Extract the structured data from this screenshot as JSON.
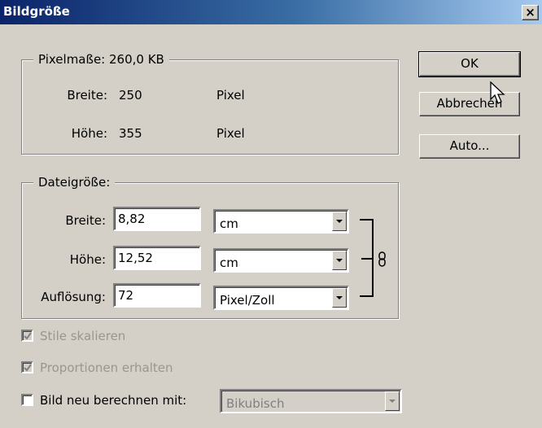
{
  "window": {
    "title": "Bildgröße"
  },
  "pixel_group": {
    "legend": "Pixelmaße: 260,0 KB",
    "width_label": "Breite:",
    "width_value": "250",
    "width_unit": "Pixel",
    "height_label": "Höhe:",
    "height_value": "355",
    "height_unit": "Pixel"
  },
  "doc_group": {
    "legend": "Dateigröße:",
    "width_label": "Breite:",
    "width_value": "8,82",
    "width_unit": "cm",
    "height_label": "Höhe:",
    "height_value": "12,52",
    "height_unit": "cm",
    "resolution_label": "Auflösung:",
    "resolution_value": "72",
    "resolution_unit": "Pixel/Zoll"
  },
  "options": {
    "scale_styles": {
      "label": "Stile skalieren",
      "checked": true,
      "enabled": false
    },
    "constrain": {
      "label": "Proportionen erhalten",
      "checked": true,
      "enabled": false
    },
    "resample": {
      "label": "Bild neu berechnen mit:",
      "checked": false,
      "enabled": true
    },
    "resample_method": "Bikubisch"
  },
  "buttons": {
    "ok": "OK",
    "cancel": "Abbrechen",
    "auto": "Auto..."
  },
  "icons": {
    "close": "close-icon",
    "link": "chain-link-icon",
    "cursor": "mouse-pointer-icon"
  }
}
